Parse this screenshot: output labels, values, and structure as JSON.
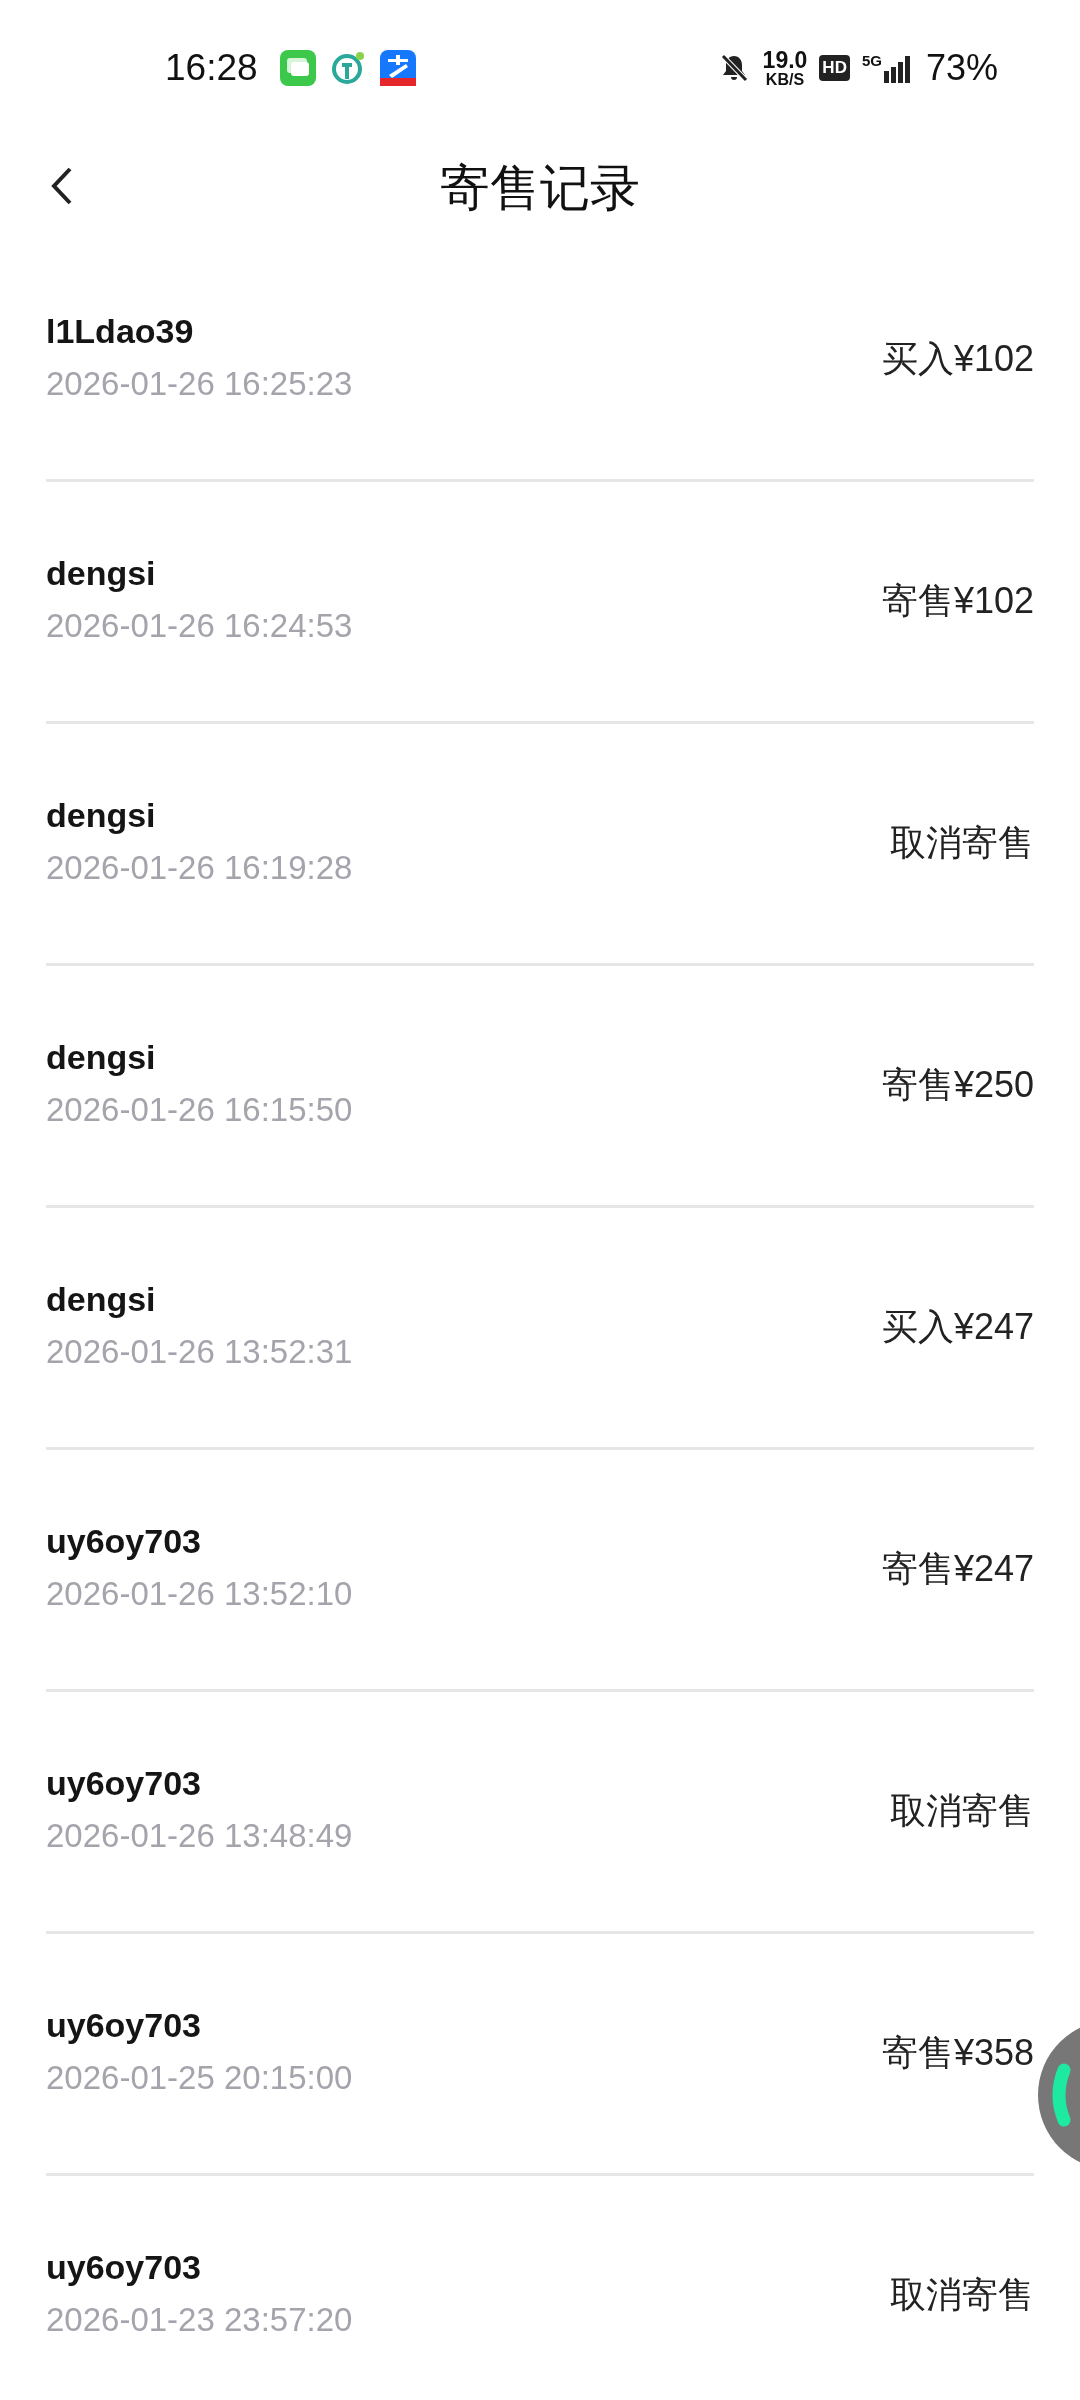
{
  "status_bar": {
    "time": "16:28",
    "net_speed": "19.0",
    "net_unit": "KB/S",
    "hd": "HD",
    "network": "5G",
    "battery": "73%"
  },
  "header": {
    "title": "寄售记录"
  },
  "records": [
    {
      "user": "l1Ldao39",
      "time": "2026-01-26 16:25:23",
      "action": "买入¥102"
    },
    {
      "user": "dengsi",
      "time": "2026-01-26 16:24:53",
      "action": "寄售¥102"
    },
    {
      "user": "dengsi",
      "time": "2026-01-26 16:19:28",
      "action": "取消寄售"
    },
    {
      "user": "dengsi",
      "time": "2026-01-26 16:15:50",
      "action": "寄售¥250"
    },
    {
      "user": "dengsi",
      "time": "2026-01-26 13:52:31",
      "action": "买入¥247"
    },
    {
      "user": "uy6oy703",
      "time": "2026-01-26 13:52:10",
      "action": "寄售¥247"
    },
    {
      "user": "uy6oy703",
      "time": "2026-01-26 13:48:49",
      "action": "取消寄售"
    },
    {
      "user": "uy6oy703",
      "time": "2026-01-25 20:15:00",
      "action": "寄售¥358"
    },
    {
      "user": "uy6oy703",
      "time": "2026-01-23 23:57:20",
      "action": "取消寄售"
    }
  ]
}
